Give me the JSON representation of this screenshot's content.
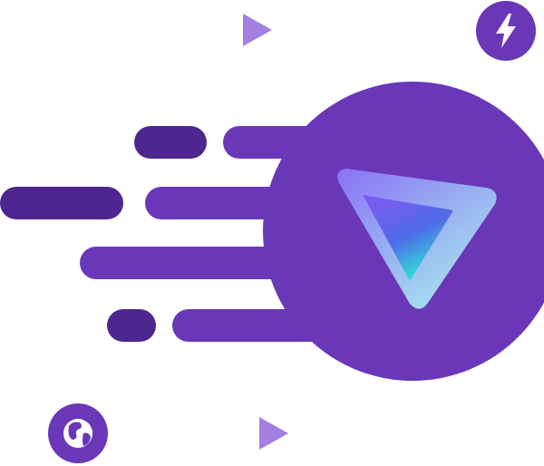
{
  "illustration": {
    "colors": {
      "background": "#ffffff",
      "circle_fill": "#6a37b8",
      "speed_line_fill": "#6a37b8",
      "speed_line_dark_fill": "#4d2690",
      "play_triangle_fill": "#a37fe1",
      "badge_fill": "#6a37b8",
      "badge_icon_fill": "#ffffff",
      "logo_gradient_start": "#7a5cf0",
      "logo_gradient_mid": "#4f6be8",
      "logo_gradient_end": "#2ee5d5",
      "logo_frame_start": "#8b78f5",
      "logo_frame_end": "#a9f0ee"
    },
    "icons": {
      "logo": "triangle-logo-icon",
      "top_play": "play-icon",
      "bottom_play": "play-icon",
      "lightning_badge": "lightning-bolt-icon",
      "globe_badge": "globe-icon"
    }
  }
}
